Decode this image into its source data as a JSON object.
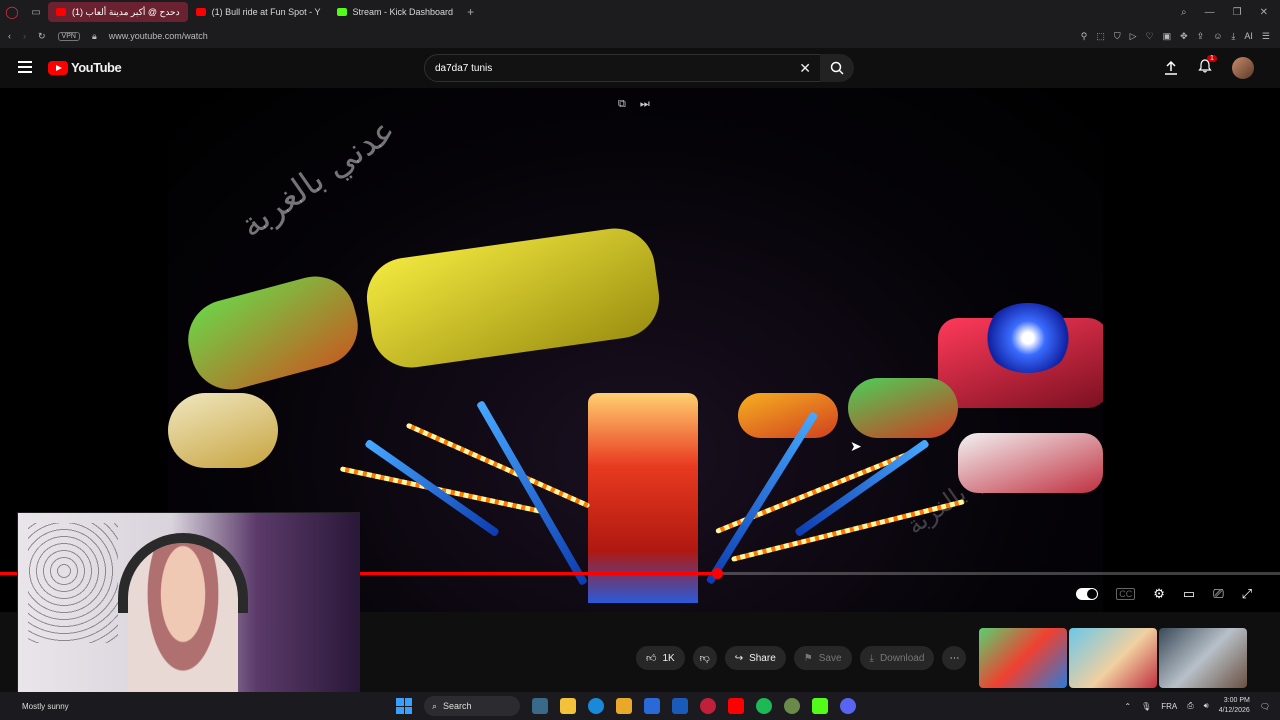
{
  "browser": {
    "tabs": [
      {
        "label": "دحدح @ أكبر مدينة ألعاب (1)",
        "active": true
      },
      {
        "label": "(1) Bull ride at Fun Spot - Y",
        "active": false
      },
      {
        "label": "Stream - Kick Dashboard",
        "active": false
      }
    ],
    "vpn_label": "VPN",
    "url": "www.youtube.com/watch",
    "ai_label": "AI"
  },
  "youtube": {
    "logo_text": "YouTube",
    "search_value": "da7da7 tunis",
    "notification_count": "1"
  },
  "video": {
    "watermark": "عدني بالغربة",
    "progress_fraction": 0.56,
    "cc_label": "CC"
  },
  "actions": {
    "like_count": "1K",
    "share_label": "Share",
    "save_label": "Save",
    "download_label": "Download"
  },
  "taskbar": {
    "weather": "Mostly sunny",
    "search_label": "Search",
    "language": "FRA",
    "time": "3:00 PM",
    "date": "4/12/2026"
  },
  "colors": {
    "youtube_red": "#ff0000",
    "active_tab": "#6b2230",
    "background": "#0f0f0f"
  }
}
